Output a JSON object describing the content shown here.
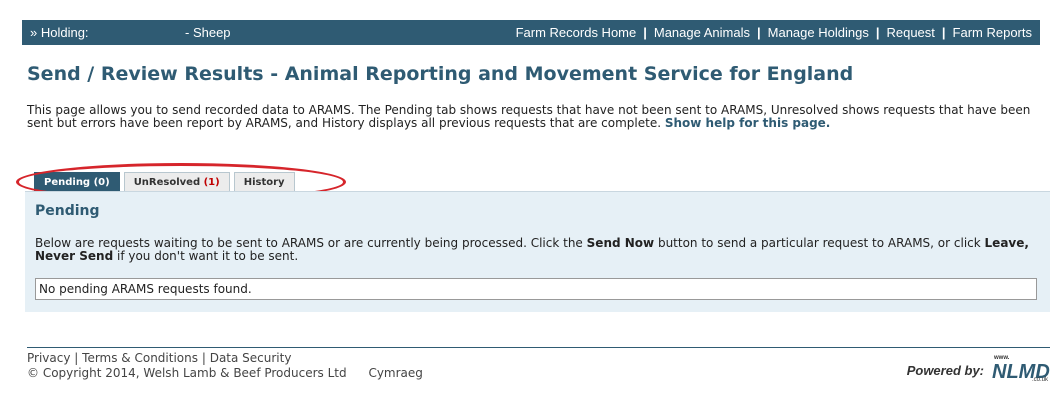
{
  "topbar": {
    "holding_label": "» Holding:",
    "species": "- Sheep",
    "nav": [
      "Farm Records Home",
      "Manage Animals",
      "Manage Holdings",
      "Request",
      "Farm Reports"
    ],
    "color": "#2f5b73"
  },
  "page": {
    "title": "Send / Review Results - Animal Reporting and Movement Service for England",
    "intro": "This page allows you to send recorded data to ARAMS. The Pending tab shows requests that have not been sent to ARAMS, Unresolved shows requests that have been sent but errors have been report by ARAMS, and History displays all previous requests that are complete.",
    "help_link": "Show help for this page."
  },
  "tabs": {
    "pending": {
      "label": "Pending",
      "count": "(0)"
    },
    "unresolved": {
      "label": "UnResolved",
      "count": "(1)"
    },
    "history": {
      "label": "History"
    }
  },
  "panel": {
    "heading": "Pending",
    "desc_1": "Below are requests waiting to be sent to ARAMS or are currently being processed. Click the",
    "send_now": "Send Now",
    "desc_2": "button to send a particular request to ARAMS, or click",
    "leave": "Leave, Never Send",
    "desc_3": "if you don't want it to be sent.",
    "empty_message": "No pending ARAMS requests found."
  },
  "footer": {
    "links": [
      "Privacy",
      "Terms & Conditions",
      "Data Security"
    ],
    "copyright": "© Copyright 2014, Welsh Lamb & Beef Producers Ltd",
    "language": "Cymraeg",
    "powered_by": "Powered by:",
    "logo_text": "NLMD",
    "logo_www": "www.",
    "logo_tld": ".co.uk"
  },
  "colors": {
    "accent": "#2f5b73",
    "panel_bg": "#e6f0f6",
    "alert": "#c00000",
    "annotation": "#d6252b"
  }
}
